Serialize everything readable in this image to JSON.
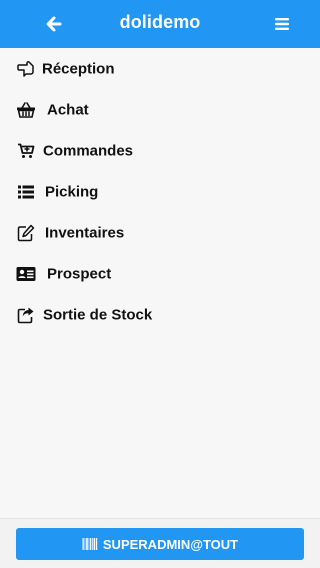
{
  "header": {
    "title": "dolidemo",
    "back_icon": "arrow-left-icon",
    "menu_icon": "hamburger-icon"
  },
  "menu": {
    "items": [
      {
        "label": "Réception",
        "icon": "hand-point-left-icon"
      },
      {
        "label": "Achat",
        "icon": "basket-icon"
      },
      {
        "label": "Commandes",
        "icon": "cart-plus-icon"
      },
      {
        "label": "Picking",
        "icon": "list-icon"
      },
      {
        "label": "Inventaires",
        "icon": "edit-icon"
      },
      {
        "label": "Prospect",
        "icon": "address-card-icon"
      },
      {
        "label": "Sortie de Stock",
        "icon": "share-square-icon"
      }
    ]
  },
  "footer": {
    "user_label": "SUPERADMIN@TOUT",
    "user_icon": "barcode-icon"
  },
  "colors": {
    "accent": "#2196f3",
    "background": "#f7f7f7",
    "text": "#111111"
  }
}
